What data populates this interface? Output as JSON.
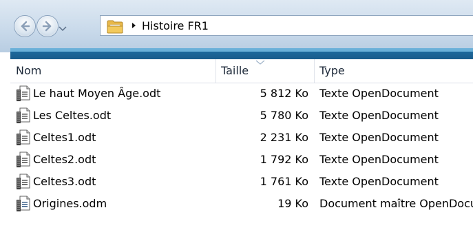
{
  "address": {
    "crumb": "Histoire FR1"
  },
  "columns": {
    "name": "Nom",
    "size": "Taille",
    "type": "Type"
  },
  "files": [
    {
      "name": "Le haut Moyen Âge.odt",
      "size": "5 812 Ko",
      "type": "Texte OpenDocument",
      "icon": "odt-document-icon"
    },
    {
      "name": "Les Celtes.odt",
      "size": "5 780 Ko",
      "type": "Texte OpenDocument",
      "icon": "odt-document-icon"
    },
    {
      "name": "Celtes1.odt",
      "size": "2 231 Ko",
      "type": "Texte OpenDocument",
      "icon": "odt-document-icon"
    },
    {
      "name": "Celtes2.odt",
      "size": "1 792 Ko",
      "type": "Texte OpenDocument",
      "icon": "odt-document-icon"
    },
    {
      "name": "Celtes3.odt",
      "size": "1 761 Ko",
      "type": "Texte OpenDocument",
      "icon": "odt-document-icon"
    },
    {
      "name": "Origines.odm",
      "size": "19 Ko",
      "type": "Document maître OpenDocument",
      "icon": "odm-master-document-icon"
    }
  ],
  "colors": {
    "strip": "#1d6fa3",
    "header_border": "#d9dee6"
  }
}
